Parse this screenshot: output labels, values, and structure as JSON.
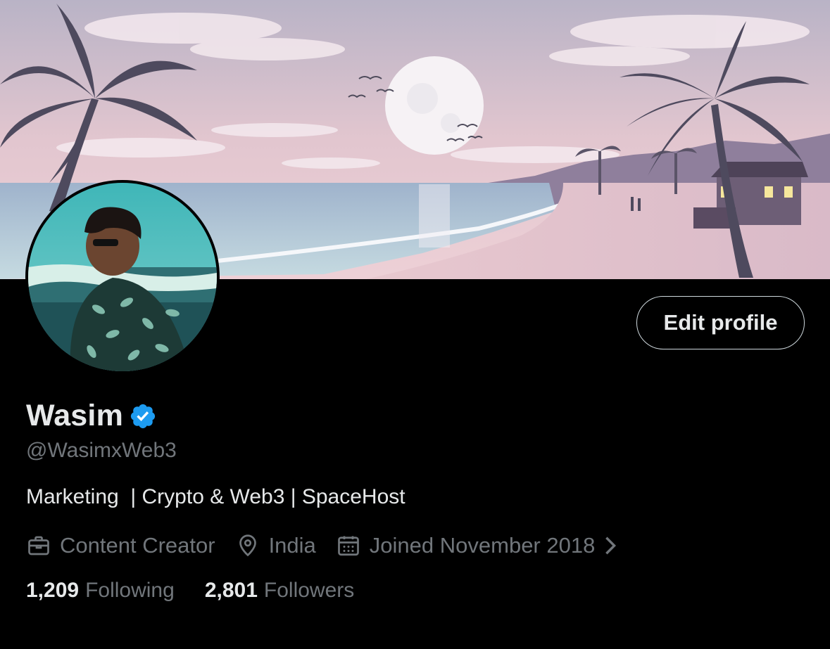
{
  "profile": {
    "display_name": "Wasim",
    "verified": true,
    "handle": "@WasimxWeb3",
    "bio": "Marketing  | Crypto & Web3 | SpaceHost",
    "profession": "Content Creator",
    "location": "India",
    "joined": "Joined November 2018",
    "following_count": "1,209",
    "following_label": "Following",
    "followers_count": "2,801",
    "followers_label": "Followers"
  },
  "actions": {
    "edit_label": "Edit profile"
  },
  "icons": {
    "verified": "verified-badge-icon",
    "profession": "briefcase-icon",
    "location": "location-pin-icon",
    "joined": "calendar-icon",
    "joined_more": "chevron-right-icon"
  },
  "colors": {
    "background": "#000000",
    "primary_text": "#e7e9ea",
    "secondary_text": "#71767b",
    "verified_blue": "#1d9bf0",
    "button_border": "#cfd9de"
  }
}
